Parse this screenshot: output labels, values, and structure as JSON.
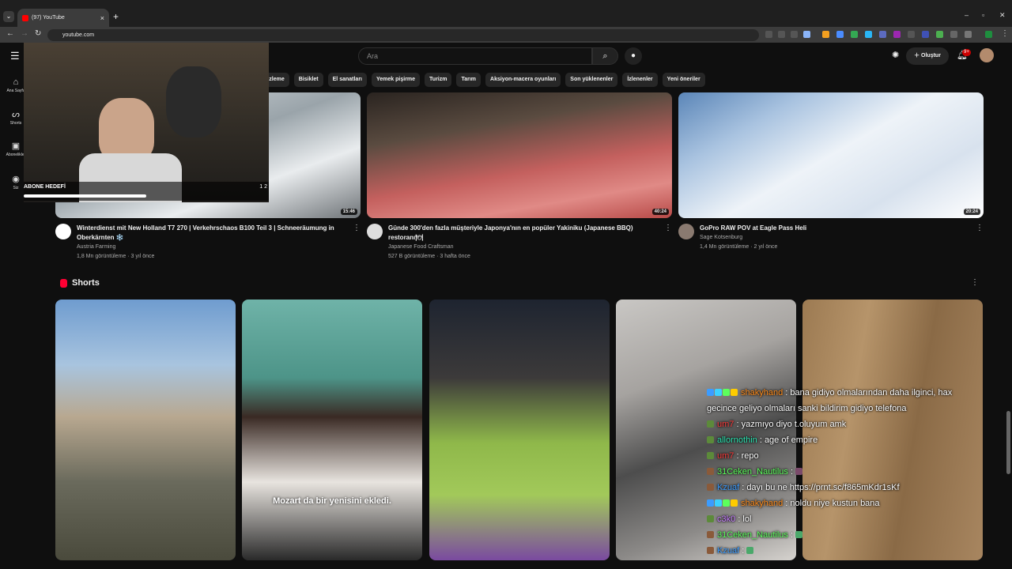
{
  "browser": {
    "tab_title": "(97) YouTube",
    "url": "youtube.com",
    "new_tab": "+",
    "tab_close": "×"
  },
  "header": {
    "search_placeholder": "Ara",
    "create_label": "Oluştur",
    "notification_count": "9+"
  },
  "chips": [
    "üzleme",
    "Bisiklet",
    "El sanatları",
    "Yemek pişirme",
    "Turizm",
    "Tarım",
    "Aksiyon-macera oyunları",
    "Son yüklenenler",
    "İzlenenler",
    "Yeni öneriler"
  ],
  "sidebar": {
    "items": [
      {
        "label": "Ana Sayfa",
        "icon": "home-icon"
      },
      {
        "label": "Shorts",
        "icon": "shorts-icon"
      },
      {
        "label": "Abonelikler",
        "icon": "subscriptions-icon"
      },
      {
        "label": "Siz",
        "icon": "you-icon"
      }
    ]
  },
  "videos": [
    {
      "title": "Winterdienst mit New Holland T7 270 | Verkehrschaos B100 Teil 3 | Schneeräumung in Oberkärnten ❄️",
      "channel": "Austria Farming",
      "meta": "1,8 Mn görüntüleme · 3 yıl önce",
      "duration": "15:46"
    },
    {
      "title": "Günde 300'den fazla müşteriyle Japonya'nın en popüler Yakiniku (Japanese BBQ) restoranı🍽",
      "channel": "Japanese Food Craftsman",
      "meta": "527 B görüntüleme · 3 hafta önce",
      "duration": "40:24"
    },
    {
      "title": "GoPro RAW POV at Eagle Pass Heli",
      "channel": "Sage Kotsenburg",
      "meta": "1,4 Mn görüntüleme · 2 yıl önce",
      "duration": "20:24"
    }
  ],
  "shorts": {
    "heading": "Shorts",
    "caption_2": "Mozart da bir yenisini ekledi."
  },
  "overlay": {
    "goal_label": "ABONE HEDEFİ",
    "goal_numbers": "1  2",
    "goal_progress": 0.5
  },
  "chat": [
    {
      "user": "shakyhand",
      "color": "#ff8c1a",
      "text": ": bana gidiyo olmalarından daha ilginci, hax"
    },
    {
      "user": "",
      "color": "#ffffff",
      "text": "gecince geliyo olmaları sanki bildirim gidiyo telefona"
    },
    {
      "user": "um7",
      "color": "#ff3b3b",
      "text": ": yazmıyo diyo t.oluyum amk"
    },
    {
      "user": "allornothin",
      "color": "#2ee6b3",
      "text": ": age of empire"
    },
    {
      "user": "um7",
      "color": "#ff3b3b",
      "text": ": repo"
    },
    {
      "user": "31Ceken_Nautilus",
      "color": "#5cff5c",
      "text": ":"
    },
    {
      "user": "Kzuaf",
      "color": "#3b9cff",
      "text": ": dayı bu ne https://prnt.sc/f865mKdr1sKf"
    },
    {
      "user": "shakyhand",
      "color": "#ff8c1a",
      "text": ": noldu niye kustun bana"
    },
    {
      "user": "c3k0",
      "color": "#c77dff",
      "text": ": lol"
    },
    {
      "user": "31Ceken_Nautilus",
      "color": "#5cff5c",
      "text": ":"
    },
    {
      "user": "Kzuaf",
      "color": "#3b9cff",
      "text": ":"
    }
  ]
}
